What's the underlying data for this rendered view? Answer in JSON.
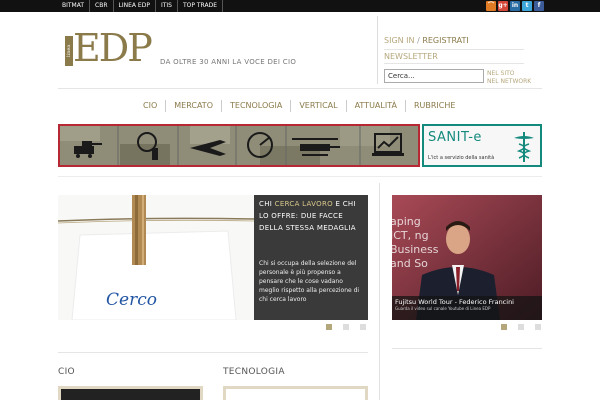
{
  "topbar": {
    "links": [
      "BITMAT",
      "CBR",
      "LINEA EDP",
      "ITIS",
      "TOP TRADE"
    ],
    "social": [
      {
        "name": "rss-icon",
        "glyph": "⌒",
        "color": "#e07b25"
      },
      {
        "name": "google-plus-icon",
        "glyph": "g+",
        "color": "#d4483a"
      },
      {
        "name": "linkedin-icon",
        "glyph": "in",
        "color": "#2a6ca4"
      },
      {
        "name": "twitter-icon",
        "glyph": "t",
        "color": "#3fa6d9"
      },
      {
        "name": "facebook-icon",
        "glyph": "f",
        "color": "#3b5b99"
      }
    ]
  },
  "header": {
    "logo_small": "linea",
    "logo_main": "EDP",
    "tagline": "DA OLTRE 30 ANNI LA VOCE DEI CIO",
    "signin": "SIGN IN",
    "signin_sep": "/",
    "register": "REGISTRATI",
    "newsletter": "NEWSLETTER",
    "search_value": "Cerca...",
    "search_opt1": "NEL SITO",
    "search_opt2": "NEL NETWORK"
  },
  "nav": [
    "CIO",
    "MERCATO",
    "TECNOLOGIA",
    "VERTICAL",
    "ATTUALITÀ",
    "RUBRICHE"
  ],
  "banners": {
    "sanit_title": "SANIT-e",
    "sanit_sub": "L'ict a servizio della sanità"
  },
  "slider": {
    "title_pre": "CHI ",
    "title_hl": "CERCA LAVORO",
    "title_post": " E CHI LO OFFRE: DUE FACCE DELLA STESSA MEDAGLIA",
    "excerpt": "Chi si occupa della selezione del personale è più propenso a pensare che le cose vadano meglio rispetto alla percezione di chi cerca lavoro",
    "card_text": "Cerco",
    "dots": 3,
    "active_dot": 0
  },
  "video": {
    "title": "Fujitsu World Tour - Federico Francini",
    "subtitle": "Guarda il video sul canale Youtube di Linea EDP",
    "bg_text": "aping ICT, ng Business and So"
  },
  "sections": {
    "cio": "CIO",
    "tecnologia": "TECNOLOGIA"
  },
  "colors": {
    "accent": "#8b7a4a",
    "gold_light": "#b5a77c",
    "military_border": "#b62834",
    "sanit": "#148a7d"
  }
}
